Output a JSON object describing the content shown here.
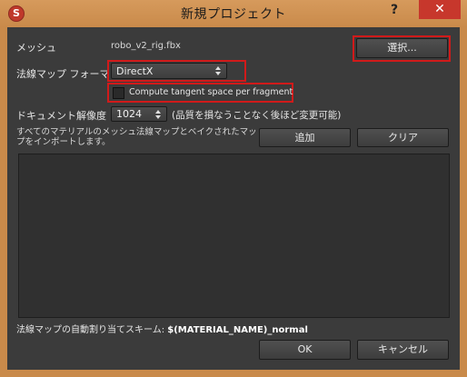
{
  "window": {
    "title": "新規プロジェクト",
    "help_label": "?",
    "close_label": "✕"
  },
  "mesh": {
    "label": "メッシュ",
    "filename": "robo_v2_rig.fbx",
    "select_button": "選択..."
  },
  "normal_map_format": {
    "label": "法線マップ フォーマット",
    "selected": "DirectX",
    "compute_tangent_label": "Compute tangent space per fragment",
    "compute_tangent_checked": false
  },
  "doc_resolution": {
    "label": "ドキュメント解像度",
    "selected": "1024",
    "note": "(品質を損なうことなく後ほど変更可能)"
  },
  "material_import": {
    "description": "すべてのマテリアルのメッシュ法線マップとベイクされたマップをインポートします。",
    "add_button": "追加",
    "clear_button": "クリア",
    "items": []
  },
  "auto_assign": {
    "label": "法線マップの自動割り当てスキーム:",
    "scheme": "$(MATERIAL_NAME)_normal"
  },
  "footer": {
    "ok_button": "OK",
    "cancel_button": "キャンセル"
  },
  "colors": {
    "titlebar": "#c98a4a",
    "client_bg": "#3b3b3b",
    "highlight": "#d11a1a",
    "close_button": "#c7372c"
  }
}
